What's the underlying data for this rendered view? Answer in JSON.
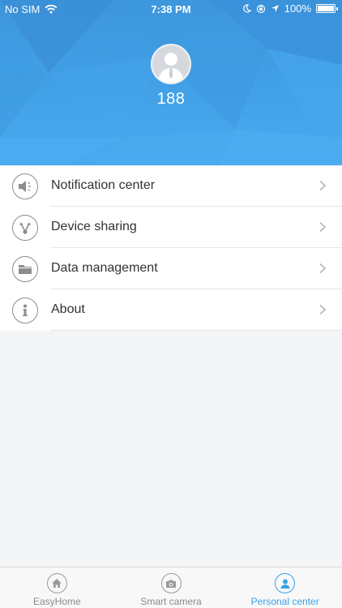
{
  "status_bar": {
    "carrier": "No SIM",
    "time": "7:38 PM",
    "battery": "100%"
  },
  "profile": {
    "name": "188"
  },
  "menu": {
    "items": [
      {
        "label": "Notification center",
        "icon": "speaker-icon"
      },
      {
        "label": "Device sharing",
        "icon": "share-icon"
      },
      {
        "label": "Data management",
        "icon": "folder-icon"
      },
      {
        "label": "About",
        "icon": "info-icon"
      }
    ]
  },
  "tabbar": {
    "tabs": [
      {
        "label": "EasyHome",
        "icon": "home-icon",
        "active": false
      },
      {
        "label": "Smart camera",
        "icon": "camera-icon",
        "active": false
      },
      {
        "label": "Personal center",
        "icon": "person-icon",
        "active": true
      }
    ]
  },
  "colors": {
    "header": "#41a0e6",
    "accent": "#35a3e8",
    "background": "#f4f5f7"
  }
}
